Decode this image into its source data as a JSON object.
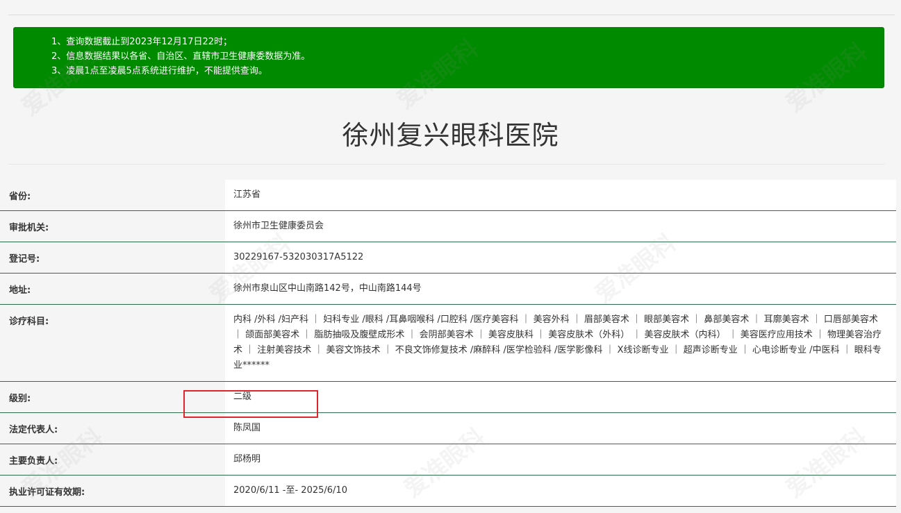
{
  "notice": {
    "lines": [
      "1、查询数据截止到2023年12月17日22时；",
      "2、信息数据结果以各省、自治区、直辖市卫生健康委数据为准。",
      "3、凌晨1点至凌晨5点系统进行维护，不能提供查询。"
    ]
  },
  "hospital": {
    "name": "徐州复兴眼科医院"
  },
  "rows": [
    {
      "label": "省份:",
      "value": "江苏省"
    },
    {
      "label": "审批机关:",
      "value": "徐州市卫生健康委员会"
    },
    {
      "label": "登记号:",
      "value": "30229167-532030317A5122"
    },
    {
      "label": "地址:",
      "value": "徐州市泉山区中山南路142号，中山南路144号"
    },
    {
      "label": "诊疗科目:",
      "value": "内科 /外科 /妇产科 ｜ 妇科专业 /眼科 /耳鼻咽喉科 /口腔科 /医疗美容科 ｜ 美容外科 ｜ 眉部美容术 ｜ 眼部美容术 ｜ 鼻部美容术 ｜ 耳廓美容术 ｜ 口唇部美容术 ｜ 颌面部美容术 ｜ 脂肪抽吸及腹壁成形术 ｜ 会阴部美容术 ｜ 美容皮肤科 ｜ 美容皮肤术（外科） ｜ 美容皮肤术（内科） ｜ 美容医疗应用技术 ｜ 物理美容治疗术 ｜ 注射美容技术 ｜ 美容文饰技术 ｜ 不良文饰修复技术 /麻醉科 /医学检验科 /医学影像科 ｜ X线诊断专业 ｜ 超声诊断专业 ｜ 心电诊断专业 /中医科 ｜ 眼科专业******"
    },
    {
      "label": "级别:",
      "value": "二级"
    },
    {
      "label": "法定代表人:",
      "value": "陈凤国"
    },
    {
      "label": "主要负责人:",
      "value": "邱杨明"
    },
    {
      "label": "执业许可证有效期:",
      "value": "2020/6/11 -至- 2025/6/10"
    }
  ],
  "watermark": {
    "text": "爱准眼科"
  },
  "colors": {
    "notice_bg": "#008a00",
    "row_divider": "#2e6b4a",
    "highlight": "#e0242c"
  }
}
